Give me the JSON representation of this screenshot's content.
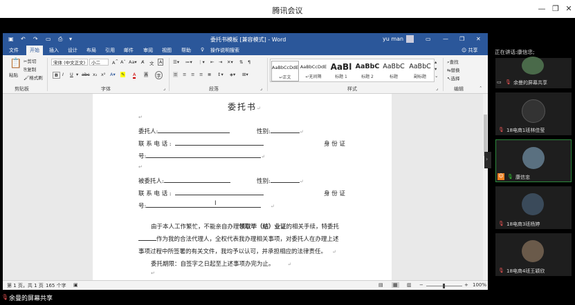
{
  "meeting": {
    "app_title": "腾讯会议",
    "screen_share_label": "余曼的屏幕共享",
    "speaking_label": "正在讲话:康信忠;",
    "participants": [
      {
        "name": "余曼的屏幕共享",
        "color": "#4a6a4a"
      },
      {
        "name": "18电商1班林佳莹",
        "color": "#333"
      },
      {
        "name": "康信忠",
        "color": "#5a7080"
      },
      {
        "name": "18电商3班杨婷",
        "color": "#3a4a5a"
      },
      {
        "name": "18电商4班王颖欣",
        "color": "#6a5a4a"
      }
    ]
  },
  "word": {
    "doc_title": "委托书模板 [兼容模式] - Word",
    "user": "yu man",
    "menu": [
      "文件",
      "开始",
      "插入",
      "设计",
      "布局",
      "引用",
      "邮件",
      "审阅",
      "视图",
      "帮助"
    ],
    "tell_me": "操作说明搜索",
    "share": "共享",
    "clipboard": {
      "paste": "粘贴",
      "cut": "剪切",
      "copy": "复制",
      "format_painter": "格式刷",
      "group": "剪贴板"
    },
    "font": {
      "name": "宋体 (中文正文)",
      "size": "小二",
      "group": "字体"
    },
    "paragraph_group": "段落",
    "styles": {
      "group": "样式",
      "items": [
        {
          "preview": "AaBbCcDdE",
          "name": "↵正文"
        },
        {
          "preview": "AaBbCcDdE",
          "name": "↵无间隔"
        },
        {
          "preview": "AaBl",
          "name": "标题 1"
        },
        {
          "preview": "AaBbC",
          "name": "标题 2"
        },
        {
          "preview": "AaBbC",
          "name": "标题"
        },
        {
          "preview": "AaBbC",
          "name": "副标题"
        }
      ]
    },
    "editing": {
      "find": "查找",
      "replace": "替换",
      "select": "选择",
      "group": "编辑"
    },
    "document": {
      "title": "委托书",
      "principal_label": "委托人:",
      "gender_label": "性别:",
      "phone_label": "联 系 电 话 :",
      "id_label": "身 份 证",
      "id_suffix": "号:",
      "agent_label": "被委托人:",
      "para1": "由于本人工作繁忙，不能亲自办理",
      "para1_bold": "领取毕（结）业证",
      "para1_end": "的相关手续，特委托",
      "para2": "作为我的合法代理人，全权代表我办理相关事项，对委托人在办理上述",
      "para3": "事项过程中所签署的有关文件，我均予以认可，并承担相应的法律责任。",
      "para4": "委托期限：自签字之日起至上述事项办完为止。"
    },
    "status": {
      "page": "第 1 页，共 1 页",
      "words": "165 个字",
      "zoom": "100%"
    }
  }
}
